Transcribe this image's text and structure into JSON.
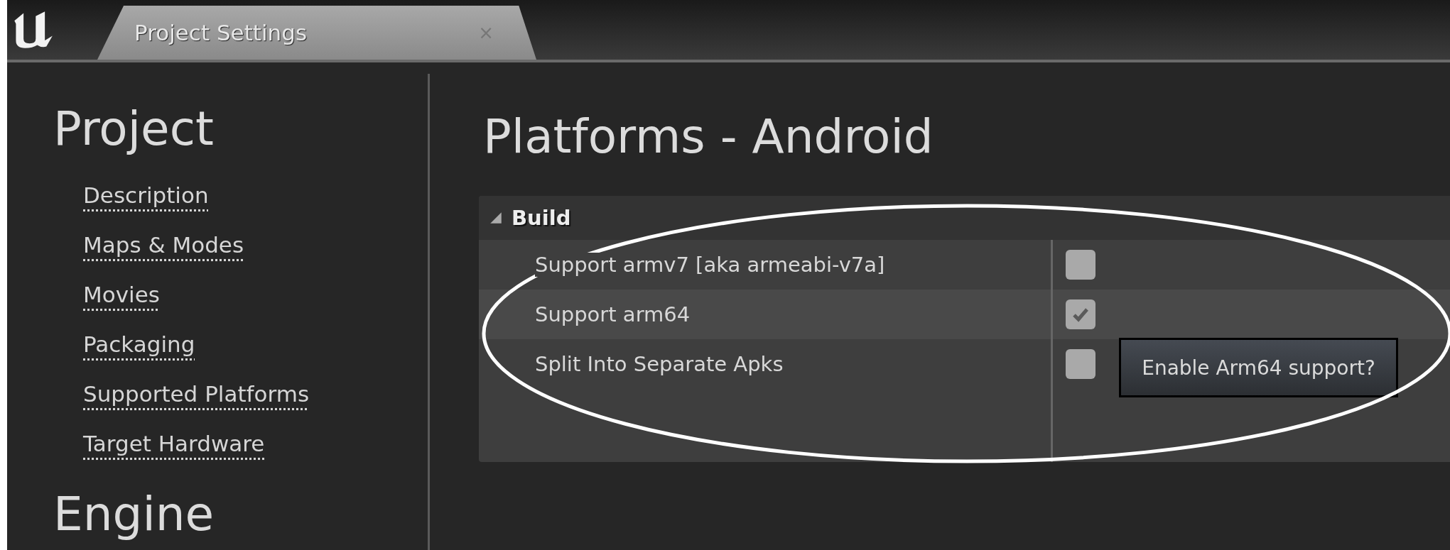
{
  "tab": {
    "title": "Project Settings",
    "close": "×"
  },
  "sidebar": {
    "sections": [
      {
        "heading": "Project",
        "items": [
          "Description",
          "Maps & Modes",
          "Movies",
          "Packaging",
          "Supported Platforms",
          "Target Hardware"
        ]
      },
      {
        "heading": "Engine"
      }
    ]
  },
  "page_title": "Platforms - Android",
  "category": {
    "title": "Build",
    "expanded": true,
    "rows": [
      {
        "label": "Support armv7 [aka armeabi-v7a]",
        "checked": false
      },
      {
        "label": "Support arm64",
        "checked": true
      },
      {
        "label": "Split Into Separate Apks",
        "checked": false
      }
    ]
  },
  "tooltip": {
    "text": "Enable Arm64 support?"
  }
}
